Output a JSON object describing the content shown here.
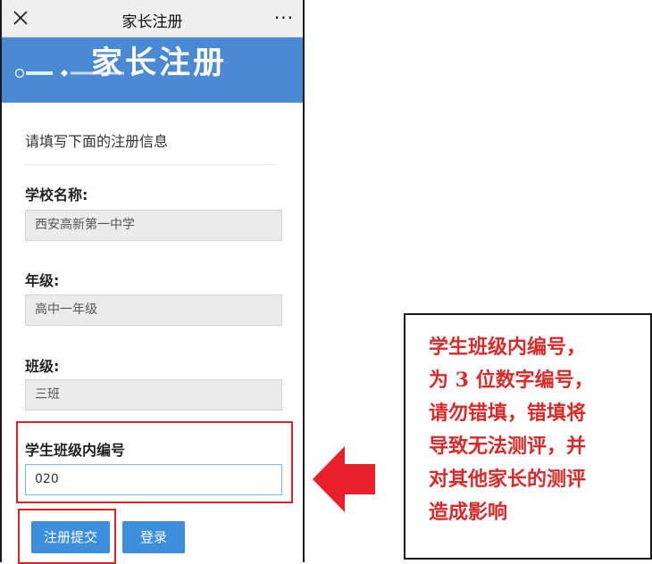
{
  "window": {
    "title": "家长注册",
    "close_icon": "close-icon",
    "more_icon": "more-icon",
    "more_glyph": "···"
  },
  "banner": {
    "title": "家长注册",
    "bg_color": "#4a8ad4"
  },
  "form": {
    "subtitle": "请填写下面的注册信息",
    "school": {
      "label": "学校名称:",
      "value": "西安高新第一中学"
    },
    "grade": {
      "label": "年级:",
      "value": "高中一年级"
    },
    "class": {
      "label": "班级:",
      "value": "三班"
    },
    "student_no": {
      "label": "学生班级内编号",
      "value": "020"
    },
    "submit_label": "注册提交",
    "login_label": "登录"
  },
  "annotation": {
    "lines": [
      "学生班级内编号，",
      "为 3 位数字编号，",
      "请勿错填，错填将",
      "导致无法测评，并",
      "对其他家长的测评",
      "造成影响"
    ],
    "color": "#d92a2a"
  }
}
